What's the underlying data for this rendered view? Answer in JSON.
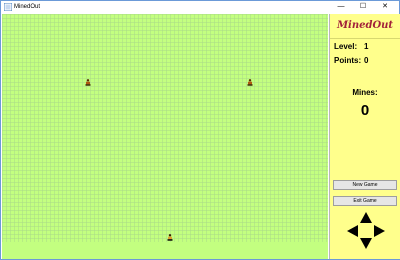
{
  "window": {
    "title": "MinedOut",
    "minimize_glyph": "—",
    "maximize_glyph": "☐",
    "close_glyph": "✕"
  },
  "board": {
    "pieces": [
      {
        "name": "enemy-piece-left"
      },
      {
        "name": "enemy-piece-right"
      },
      {
        "name": "player-piece"
      }
    ]
  },
  "sidebar": {
    "logo": "MinedOut",
    "level_label": "Level:",
    "level_value": "1",
    "points_label": "Points:",
    "points_value": "0",
    "mines_label": "Mines:",
    "mines_value": "0",
    "new_game_label": "New Game",
    "exit_game_label": "Exit Game"
  },
  "colors": {
    "board": "#c3ff80",
    "sidebar": "#ffff8c",
    "logo": "#a2203a"
  }
}
